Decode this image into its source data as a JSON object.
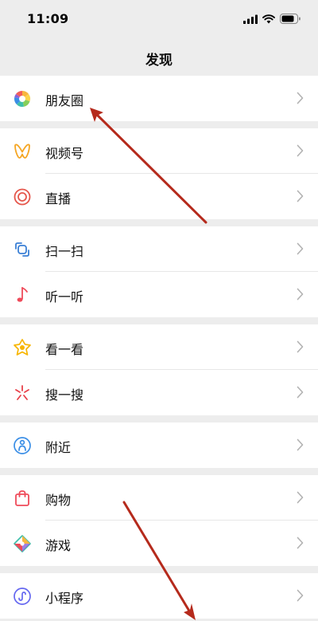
{
  "status_bar": {
    "time": "11:09"
  },
  "nav": {
    "title": "发现"
  },
  "groups": [
    {
      "items": [
        {
          "label": "朋友圈",
          "icon": "moments-icon"
        }
      ]
    },
    {
      "items": [
        {
          "label": "视频号",
          "icon": "channels-icon"
        },
        {
          "label": "直播",
          "icon": "live-icon"
        }
      ]
    },
    {
      "items": [
        {
          "label": "扫一扫",
          "icon": "scan-icon"
        },
        {
          "label": "听一听",
          "icon": "music-note-icon"
        }
      ]
    },
    {
      "items": [
        {
          "label": "看一看",
          "icon": "top-stories-icon"
        },
        {
          "label": "搜一搜",
          "icon": "search-icon"
        }
      ]
    },
    {
      "items": [
        {
          "label": "附近",
          "icon": "nearby-icon"
        }
      ]
    },
    {
      "items": [
        {
          "label": "购物",
          "icon": "shopping-bag-icon"
        },
        {
          "label": "游戏",
          "icon": "games-icon"
        }
      ]
    },
    {
      "items": [
        {
          "label": "小程序",
          "icon": "mini-programs-icon"
        }
      ]
    }
  ],
  "colors": {
    "background": "#ededed",
    "annotation_arrow": "#b52a1c",
    "chevron": "#b2b2b2"
  }
}
